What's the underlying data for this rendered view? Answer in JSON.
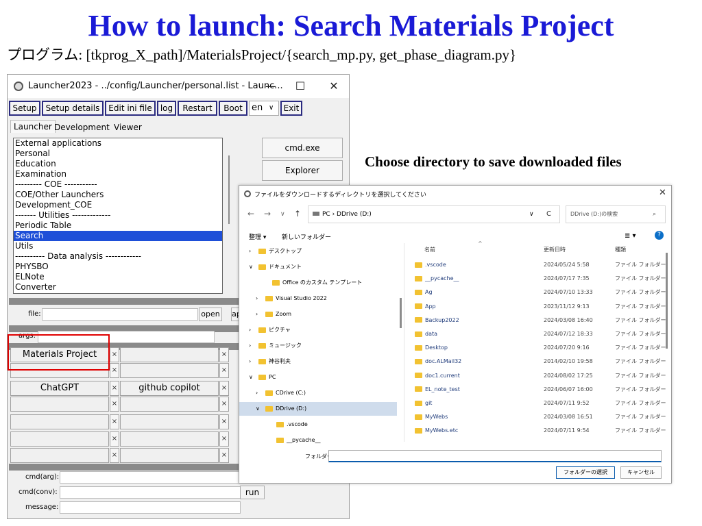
{
  "slide": {
    "title": "How to launch: Search Materials Project",
    "subtitle": "プログラム: [tkprog_X_path]/MaterialsProject/{search_mp.py, get_phase_diagram.py}",
    "caption": "Choose directory to save downloaded files"
  },
  "launcher": {
    "title": "Launcher2023 - ../config/Launcher/personal.list - Launc...",
    "window_buttons": {
      "minimize": "—",
      "maximize": "☐",
      "close": "✕"
    },
    "menu": [
      "Setup",
      "Setup details",
      "Edit ini file",
      "log",
      "Restart",
      "Boot"
    ],
    "language": "en",
    "exit_label": "Exit",
    "tabs": [
      "Launcher",
      "Development",
      "Viewer"
    ],
    "list_items": [
      "External applications",
      "Personal",
      "Education",
      "Examination",
      "--------- COE -----------",
      "COE/Other Launchers",
      "Development_COE",
      "------- Utilities -------------",
      "Periodic Table",
      "Search",
      "Utils",
      "---------- Data analysis ------------",
      "PHYSBO",
      "ELNote",
      "Converter"
    ],
    "selected_item": "Search",
    "right_buttons": [
      "cmd.exe",
      "Explorer"
    ],
    "file_label": "file:",
    "open_label": "open",
    "ap_label": "ap",
    "args_label": "args:",
    "grid_buttons": [
      [
        "Materials Project",
        ""
      ],
      [
        "",
        ""
      ],
      [
        "ChatGPT",
        "github copilot"
      ],
      [
        "",
        ""
      ],
      [
        "",
        ""
      ],
      [
        "",
        ""
      ],
      [
        "",
        ""
      ]
    ],
    "close_glyph": "×",
    "cmd_arg_label": "cmd(arg):",
    "cmd_conv_label": "cmd(conv):",
    "message_label": "message:",
    "run_label": "run"
  },
  "dialog": {
    "title": "ファイルをダウンロードするディレクトリを選択してください",
    "close": "✕",
    "nav": [
      "←",
      "→",
      "∨",
      "↑"
    ],
    "address": "PC  ›  DDrive (D:)",
    "address_dropdown": "∨",
    "refresh": "C",
    "search_placeholder": "DDrive (D:)の検索",
    "organize": "整理 ▾",
    "new_folder": "新しいフォルダー",
    "view_menu": "≣ ▾",
    "help": "?",
    "tree": [
      {
        "label": "デスクトップ",
        "prefix": "›"
      },
      {
        "label": "ドキュメント",
        "prefix": "∨"
      },
      {
        "label": "Office のカスタム テンプレート",
        "prefix": ""
      },
      {
        "label": "Visual Studio 2022",
        "prefix": "›"
      },
      {
        "label": "Zoom",
        "prefix": "›"
      },
      {
        "label": "ピクチャ",
        "prefix": "›"
      },
      {
        "label": "ミュージック",
        "prefix": "›"
      },
      {
        "label": "神谷利夫",
        "prefix": "›"
      },
      {
        "label": "PC",
        "prefix": "∨"
      },
      {
        "label": "CDrive (C:)",
        "prefix": "›"
      },
      {
        "label": "DDrive (D:)",
        "prefix": "∨"
      },
      {
        "label": ".vscode",
        "prefix": ""
      },
      {
        "label": "__pycache__",
        "prefix": ""
      }
    ],
    "columns": {
      "name": "名前",
      "date": "更新日時",
      "type": "種類"
    },
    "files": [
      {
        "name": ".vscode",
        "date": "2024/05/24 5:58",
        "type": "ファイル フォルダー"
      },
      {
        "name": "__pycache__",
        "date": "2024/07/17 7:35",
        "type": "ファイル フォルダー"
      },
      {
        "name": "Ag",
        "date": "2024/07/10 13:33",
        "type": "ファイル フォルダー"
      },
      {
        "name": "App",
        "date": "2023/11/12 9:13",
        "type": "ファイル フォルダー"
      },
      {
        "name": "Backup2022",
        "date": "2024/03/08 16:40",
        "type": "ファイル フォルダー"
      },
      {
        "name": "data",
        "date": "2024/07/12 18:33",
        "type": "ファイル フォルダー"
      },
      {
        "name": "Desktop",
        "date": "2024/07/20 9:16",
        "type": "ファイル フォルダー"
      },
      {
        "name": "doc.ALMail32",
        "date": "2014/02/10 19:58",
        "type": "ファイル フォルダー"
      },
      {
        "name": "doc1.current",
        "date": "2024/08/02 17:25",
        "type": "ファイル フォルダー"
      },
      {
        "name": "EL_note_test",
        "date": "2024/06/07 16:00",
        "type": "ファイル フォルダー"
      },
      {
        "name": "git",
        "date": "2024/07/11 9:52",
        "type": "ファイル フォルダー"
      },
      {
        "name": "MyWebs",
        "date": "2024/03/08 16:51",
        "type": "ファイル フォルダー"
      },
      {
        "name": "MyWebs.etc",
        "date": "2024/07/11 9:54",
        "type": "ファイル フォルダー"
      }
    ],
    "folder_label": "フォルダー:",
    "select_button": "フォルダーの選択",
    "cancel_button": "キャンセル"
  }
}
